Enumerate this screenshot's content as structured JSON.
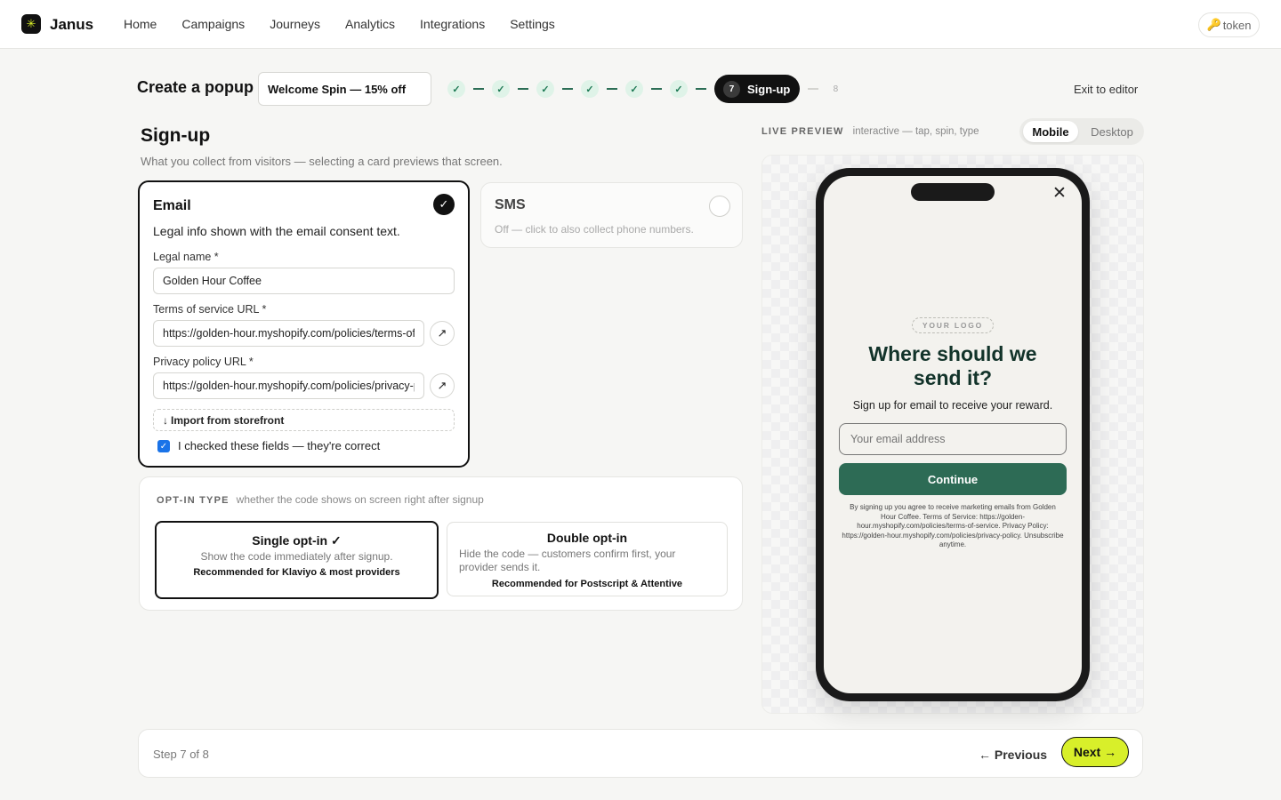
{
  "app": {
    "brand": "Janus",
    "brand_icon": "sparkle-icon"
  },
  "nav": {
    "items": [
      "Home",
      "Campaigns",
      "Journeys",
      "Analytics",
      "Integrations",
      "Settings"
    ]
  },
  "token": {
    "label": "token",
    "icon": "key-icon"
  },
  "header": {
    "title": "Create a popup",
    "popup_name": "Welcome Spin — 15% off",
    "exit_label": "Exit to editor"
  },
  "stepper": {
    "completed_mark": "✓",
    "completed_count": 6,
    "current_number": "7",
    "current_label": "Sign-up",
    "next_number": "8",
    "total_steps": 8
  },
  "section": {
    "title": "Sign-up",
    "subtitle": "What you collect from visitors — selecting a card previews that screen."
  },
  "email_card": {
    "title": "Email",
    "selected": true,
    "description": "Legal info shown with the email consent text.",
    "legal_name_label": "Legal name *",
    "legal_name_value": "Golden Hour Coffee",
    "tos_label": "Terms of service URL *",
    "tos_value": "https://golden-hour.myshopify.com/policies/terms-of-service",
    "privacy_label": "Privacy policy URL *",
    "privacy_value": "https://golden-hour.myshopify.com/policies/privacy-policy",
    "import_label": "Import from storefront",
    "confirm_label": "I checked these fields — they're correct",
    "confirm_checked": true
  },
  "sms_card": {
    "title": "SMS",
    "selected": false,
    "description": "Off — click to also collect phone numbers."
  },
  "optin": {
    "heading": "OPT-IN TYPE",
    "hint": "whether the code shows on screen right after signup",
    "options": [
      {
        "title": "Single opt-in ✓",
        "description": "Show the code immediately after signup.",
        "recommendation": "Recommended for Klaviyo & most providers",
        "selected": true
      },
      {
        "title": "Double opt-in",
        "description": "Hide the code — customers confirm first, your provider sends it.",
        "recommendation": "Recommended for Postscript & Attentive",
        "selected": false
      }
    ]
  },
  "preview": {
    "heading": "LIVE PREVIEW",
    "hint": "interactive — tap, spin, type",
    "modes": [
      "Mobile",
      "Desktop"
    ],
    "active_mode": "Mobile",
    "popup": {
      "logo_placeholder": "YOUR LOGO",
      "headline": "Where should we send it?",
      "subtext": "Sign up for email to receive your reward.",
      "email_placeholder": "Your email address",
      "button_label": "Continue",
      "legal_text": "By signing up you agree to receive marketing emails from Golden Hour Coffee. Terms of Service: https://golden-hour.myshopify.com/policies/terms-of-service. Privacy Policy: https://golden-hour.myshopify.com/policies/privacy-policy. Unsubscribe anytime."
    }
  },
  "footer": {
    "step_label": "Step 7 of 8",
    "previous_label": "← Previous",
    "next_label": "Next →"
  },
  "colors": {
    "accent": "#d8ef2a",
    "brand_green": "#2d6b55",
    "headline_green": "#12332a",
    "check_bg": "#dff3e8"
  }
}
